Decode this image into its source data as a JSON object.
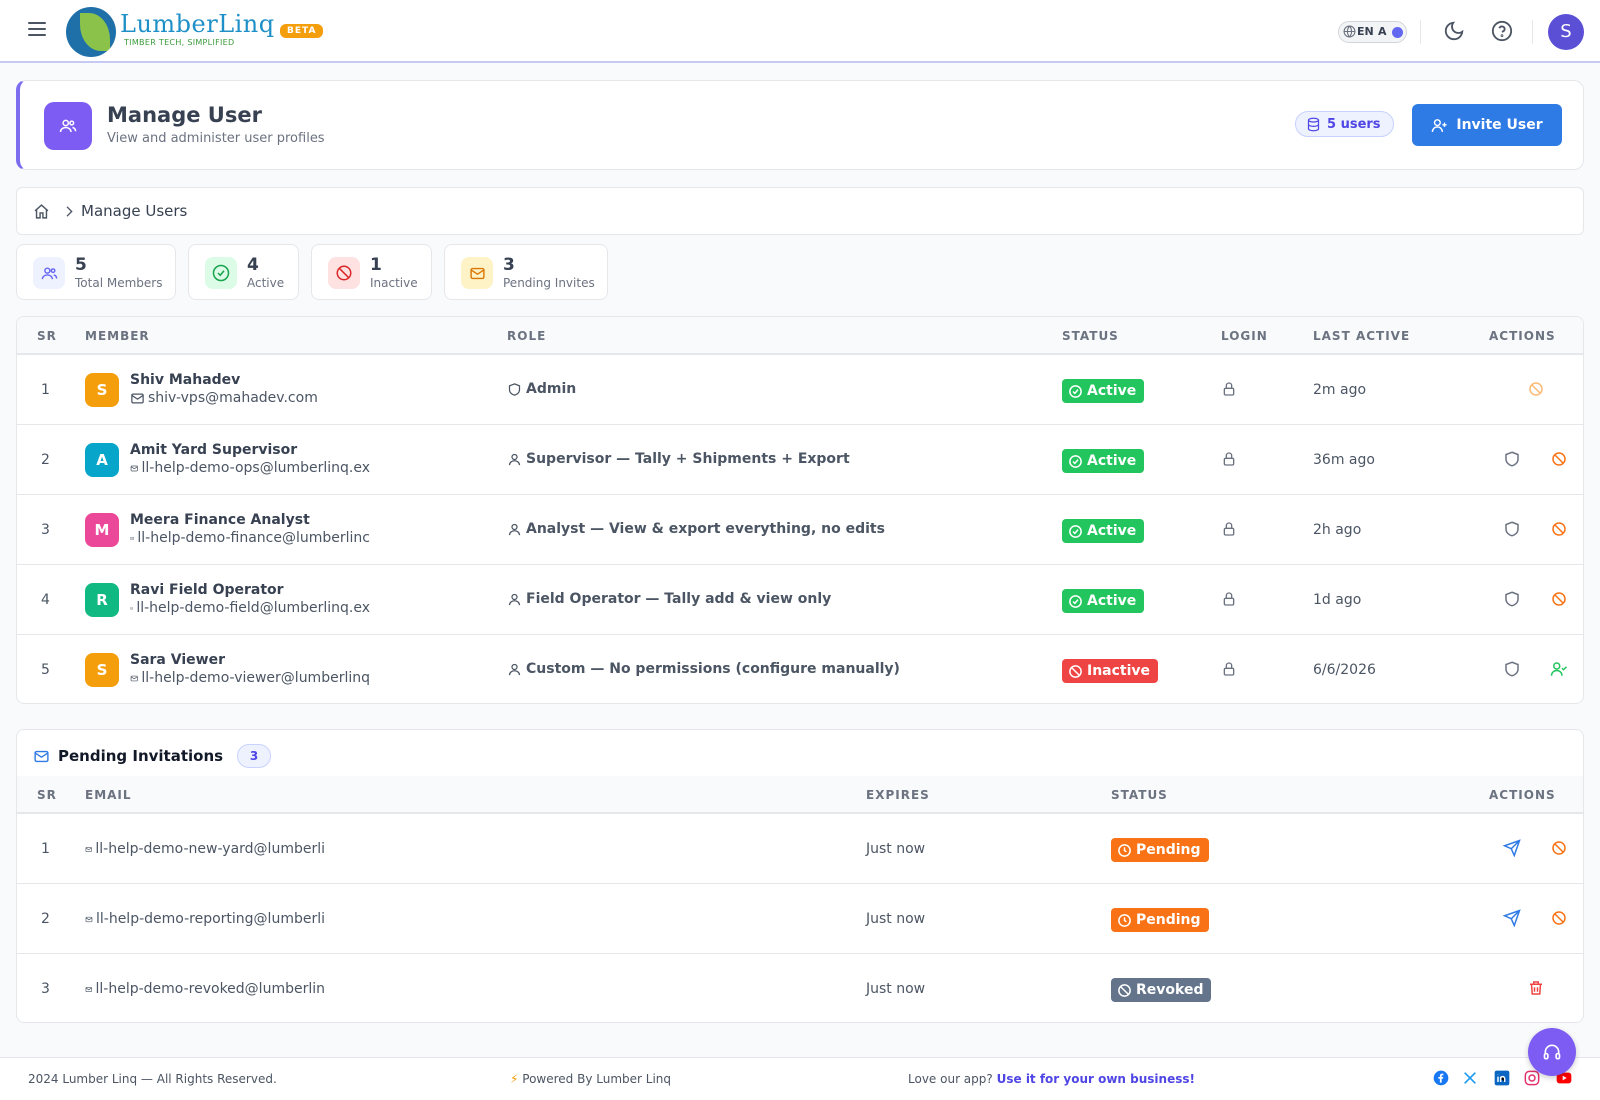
{
  "header": {
    "brand": "LumberLinq",
    "tagline": "TIMBER TECH, SIMPLIFIED",
    "beta": "BETA",
    "lang_code": "EN",
    "lang_alt": "A",
    "avatar_initial": "S"
  },
  "page": {
    "title": "Manage User",
    "subtitle": "View and administer user profiles",
    "users_count": "5 users",
    "invite_label": "Invite User"
  },
  "breadcrumb": {
    "label": "Manage Users"
  },
  "stats": [
    {
      "value": "5",
      "label": "Total Members"
    },
    {
      "value": "4",
      "label": "Active"
    },
    {
      "value": "1",
      "label": "Inactive"
    },
    {
      "value": "3",
      "label": "Pending Invites"
    }
  ],
  "members_table": {
    "headers": {
      "sr": "SR",
      "member": "MEMBER",
      "role": "ROLE",
      "status": "STATUS",
      "login": "LOGIN",
      "last_active": "LAST ACTIVE",
      "actions": "ACTIONS"
    },
    "rows": [
      {
        "sr": "1",
        "initial": "S",
        "name": "Shiv Mahadev",
        "email": "shiv-vps@mahadev.com",
        "role": "Admin",
        "status": "Active",
        "last_active": "2m ago"
      },
      {
        "sr": "2",
        "initial": "A",
        "name": "Amit Yard Supervisor",
        "email": "ll-help-demo-ops@lumberlinq.ex",
        "role": "Supervisor — Tally + Shipments + Export",
        "status": "Active",
        "last_active": "36m ago"
      },
      {
        "sr": "3",
        "initial": "M",
        "name": "Meera Finance Analyst",
        "email": "ll-help-demo-finance@lumberlinc",
        "role": "Analyst — View & export everything, no edits",
        "status": "Active",
        "last_active": "2h ago"
      },
      {
        "sr": "4",
        "initial": "R",
        "name": "Ravi Field Operator",
        "email": "ll-help-demo-field@lumberlinq.ex",
        "role": "Field Operator — Tally add & view only",
        "status": "Active",
        "last_active": "1d ago"
      },
      {
        "sr": "5",
        "initial": "S",
        "name": "Sara Viewer",
        "email": "ll-help-demo-viewer@lumberlinq",
        "role": "Custom — No permissions (configure manually)",
        "status": "Inactive",
        "last_active": "6/6/2026"
      }
    ]
  },
  "pending": {
    "title": "Pending Invitations",
    "count": "3",
    "headers": {
      "sr": "SR",
      "email": "EMAIL",
      "expires": "EXPIRES",
      "status": "STATUS",
      "actions": "ACTIONS"
    },
    "rows": [
      {
        "sr": "1",
        "email": "ll-help-demo-new-yard@lumberli",
        "expires": "Just now",
        "status": "Pending"
      },
      {
        "sr": "2",
        "email": "ll-help-demo-reporting@lumberli",
        "expires": "Just now",
        "status": "Pending"
      },
      {
        "sr": "3",
        "email": "ll-help-demo-revoked@lumberlin",
        "expires": "Just now",
        "status": "Revoked"
      }
    ]
  },
  "footer": {
    "copyright": "2024 Lumber Linq — All Rights Reserved.",
    "powered": "Powered By Lumber Linq",
    "love": "Love our app?",
    "love_link": "Use it for your own business!"
  },
  "colors": {
    "primary": "#2f7be5",
    "accent": "#7c5cf2",
    "active": "#22c55e",
    "inactive": "#ef4444",
    "pending": "#f97316",
    "revoked": "#64748b"
  }
}
